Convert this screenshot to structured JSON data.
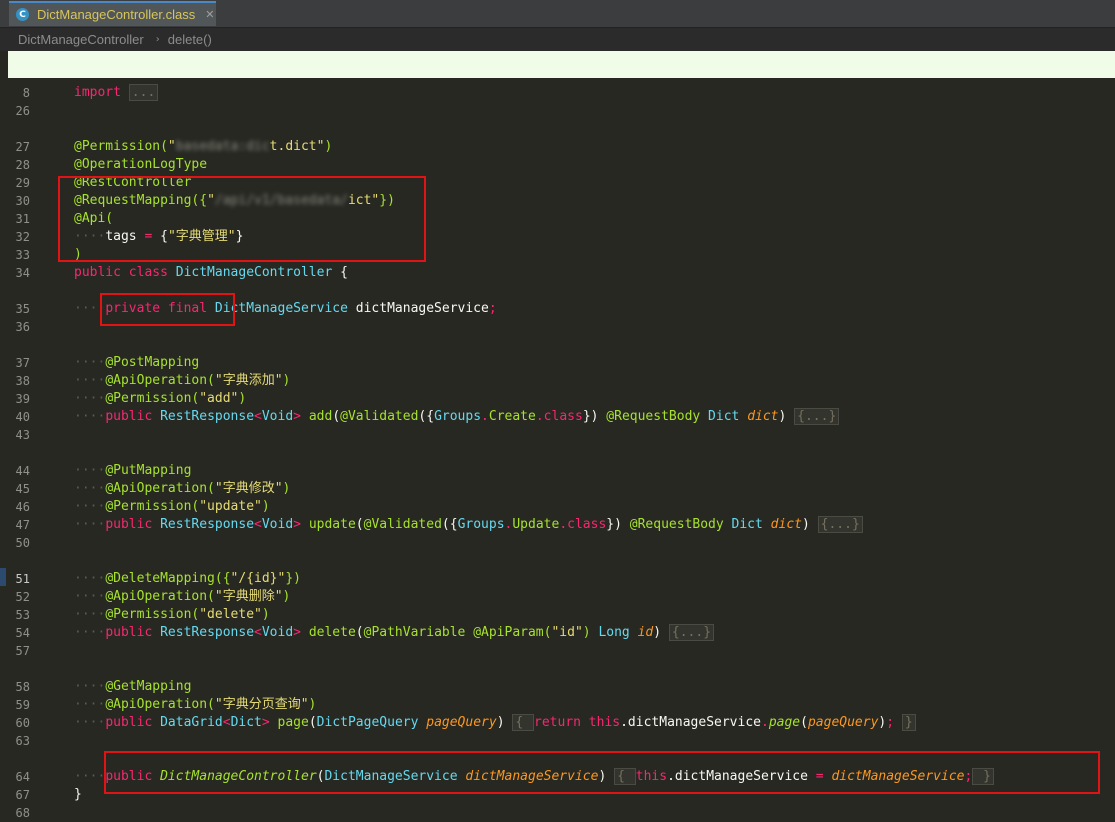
{
  "tab": {
    "title": "DictManageController.class",
    "close": "✕",
    "icon": "C"
  },
  "breadcrumb": {
    "class_name": "DictManageController",
    "separator": "›",
    "method": "delete()"
  },
  "current_line": "51",
  "lines": [
    {
      "n": "8",
      "tokens": [
        [
          "kw",
          "import"
        ],
        [
          "p",
          " "
        ],
        [
          "fold",
          "..."
        ]
      ]
    },
    {
      "n": "26",
      "tokens": []
    },
    {
      "n": "27",
      "tokens": [
        [
          "an",
          "@Permission("
        ],
        [
          "st",
          "\""
        ],
        [
          "blur",
          "basedata:dic"
        ],
        [
          "st",
          "t.dict\""
        ],
        [
          "an",
          ")"
        ]
      ]
    },
    {
      "n": "28",
      "tokens": [
        [
          "an",
          "@OperationLogType"
        ]
      ]
    },
    {
      "n": "29",
      "tokens": [
        [
          "an",
          "@RestController"
        ]
      ]
    },
    {
      "n": "30",
      "tokens": [
        [
          "an",
          "@RequestMapping({"
        ],
        [
          "st",
          "\""
        ],
        [
          "blur",
          "/api/v1/basedata/"
        ],
        [
          "st",
          "ict\""
        ],
        [
          "an",
          "})"
        ]
      ]
    },
    {
      "n": "31",
      "tokens": [
        [
          "an",
          "@Api("
        ]
      ]
    },
    {
      "n": "32",
      "tokens": [
        [
          "ind",
          "····"
        ],
        [
          "fld",
          "tags "
        ],
        [
          "kw",
          "="
        ],
        [
          "fld",
          " {"
        ],
        [
          "st",
          "\"字典管理\""
        ],
        [
          "fld",
          "}"
        ]
      ]
    },
    {
      "n": "33",
      "tokens": [
        [
          "an",
          ")"
        ]
      ]
    },
    {
      "n": "34",
      "tokens": [
        [
          "kw",
          "public class "
        ],
        [
          "ty",
          "DictManageController"
        ],
        [
          "fld",
          " {"
        ]
      ]
    },
    {
      "n": "35",
      "tokens": [
        [
          "ind",
          "····"
        ],
        [
          "kw",
          "private final "
        ],
        [
          "ty",
          "DictManageService"
        ],
        [
          "fld",
          " dictManageService"
        ],
        [
          "kw",
          ";"
        ]
      ]
    },
    {
      "n": "36",
      "tokens": []
    },
    {
      "n": "37",
      "tokens": [
        [
          "ind",
          "····"
        ],
        [
          "an",
          "@PostMapping"
        ]
      ]
    },
    {
      "n": "38",
      "tokens": [
        [
          "ind",
          "····"
        ],
        [
          "an",
          "@ApiOperation("
        ],
        [
          "st",
          "\"字典添加\""
        ],
        [
          "an",
          ")"
        ]
      ]
    },
    {
      "n": "39",
      "tokens": [
        [
          "ind",
          "····"
        ],
        [
          "an",
          "@Permission("
        ],
        [
          "st",
          "\"add\""
        ],
        [
          "an",
          ")"
        ]
      ]
    },
    {
      "n": "40",
      "tokens": [
        [
          "ind",
          "····"
        ],
        [
          "kw",
          "public "
        ],
        [
          "ty",
          "RestResponse"
        ],
        [
          "kw",
          "<"
        ],
        [
          "ty",
          "Void"
        ],
        [
          "kw",
          "> "
        ],
        [
          "an",
          "add"
        ],
        [
          "fld",
          "("
        ],
        [
          "an",
          "@Validated"
        ],
        [
          "fld",
          "({"
        ],
        [
          "ty",
          "Groups"
        ],
        [
          "kw",
          "."
        ],
        [
          "an",
          "Create"
        ],
        [
          "kw",
          ".class"
        ],
        [
          "fld",
          "}) "
        ],
        [
          "an",
          "@RequestBody "
        ],
        [
          "ty",
          "Dict "
        ],
        [
          "pa",
          "dict"
        ],
        [
          "fld",
          ") "
        ],
        [
          "fold",
          "{...}"
        ]
      ]
    },
    {
      "n": "43",
      "tokens": []
    },
    {
      "n": "44",
      "tokens": [
        [
          "ind",
          "····"
        ],
        [
          "an",
          "@PutMapping"
        ]
      ]
    },
    {
      "n": "45",
      "tokens": [
        [
          "ind",
          "····"
        ],
        [
          "an",
          "@ApiOperation("
        ],
        [
          "st",
          "\"字典修改\""
        ],
        [
          "an",
          ")"
        ]
      ]
    },
    {
      "n": "46",
      "tokens": [
        [
          "ind",
          "····"
        ],
        [
          "an",
          "@Permission("
        ],
        [
          "st",
          "\"update\""
        ],
        [
          "an",
          ")"
        ]
      ]
    },
    {
      "n": "47",
      "tokens": [
        [
          "ind",
          "····"
        ],
        [
          "kw",
          "public "
        ],
        [
          "ty",
          "RestResponse"
        ],
        [
          "kw",
          "<"
        ],
        [
          "ty",
          "Void"
        ],
        [
          "kw",
          "> "
        ],
        [
          "an",
          "update"
        ],
        [
          "fld",
          "("
        ],
        [
          "an",
          "@Validated"
        ],
        [
          "fld",
          "({"
        ],
        [
          "ty",
          "Groups"
        ],
        [
          "kw",
          "."
        ],
        [
          "an",
          "Update"
        ],
        [
          "kw",
          ".class"
        ],
        [
          "fld",
          "}) "
        ],
        [
          "an",
          "@RequestBody "
        ],
        [
          "ty",
          "Dict "
        ],
        [
          "pa",
          "dict"
        ],
        [
          "fld",
          ") "
        ],
        [
          "fold",
          "{...}"
        ]
      ]
    },
    {
      "n": "50",
      "tokens": []
    },
    {
      "n": "51",
      "tokens": [
        [
          "ind",
          "····"
        ],
        [
          "an",
          "@DeleteMapping({"
        ],
        [
          "st",
          "\"/{id}\""
        ],
        [
          "an",
          "})"
        ]
      ]
    },
    {
      "n": "52",
      "tokens": [
        [
          "ind",
          "····"
        ],
        [
          "an",
          "@ApiOperation("
        ],
        [
          "st",
          "\"字典删除\""
        ],
        [
          "an",
          ")"
        ]
      ]
    },
    {
      "n": "53",
      "tokens": [
        [
          "ind",
          "····"
        ],
        [
          "an",
          "@Permission("
        ],
        [
          "st",
          "\"delete\""
        ],
        [
          "an",
          ")"
        ]
      ]
    },
    {
      "n": "54",
      "tokens": [
        [
          "ind",
          "····"
        ],
        [
          "kw",
          "public "
        ],
        [
          "ty",
          "RestResponse"
        ],
        [
          "kw",
          "<"
        ],
        [
          "ty",
          "Void"
        ],
        [
          "kw",
          "> "
        ],
        [
          "an",
          "delete"
        ],
        [
          "fld",
          "("
        ],
        [
          "an",
          "@PathVariable @ApiParam("
        ],
        [
          "st",
          "\"id\""
        ],
        [
          "an",
          ") "
        ],
        [
          "ty",
          "Long "
        ],
        [
          "pa",
          "id"
        ],
        [
          "fld",
          ") "
        ],
        [
          "fold",
          "{...}"
        ]
      ]
    },
    {
      "n": "57",
      "tokens": []
    },
    {
      "n": "58",
      "tokens": [
        [
          "ind",
          "····"
        ],
        [
          "an",
          "@GetMapping"
        ]
      ]
    },
    {
      "n": "59",
      "tokens": [
        [
          "ind",
          "····"
        ],
        [
          "an",
          "@ApiOperation("
        ],
        [
          "st",
          "\"字典分页查询\""
        ],
        [
          "an",
          ")"
        ]
      ]
    },
    {
      "n": "60",
      "tokens": [
        [
          "ind",
          "····"
        ],
        [
          "kw",
          "public "
        ],
        [
          "ty",
          "DataGrid"
        ],
        [
          "kw",
          "<"
        ],
        [
          "ty",
          "Dict"
        ],
        [
          "kw",
          "> "
        ],
        [
          "an",
          "page"
        ],
        [
          "fld",
          "("
        ],
        [
          "ty",
          "DictPageQuery "
        ],
        [
          "pa",
          "pageQuery"
        ],
        [
          "fld",
          ") "
        ],
        [
          "fold",
          "{ "
        ],
        [
          "kw",
          "return this"
        ],
        [
          "fld",
          ".dictManageService"
        ],
        [
          "kw",
          "."
        ],
        [
          "mi",
          "page"
        ],
        [
          "fld",
          "("
        ],
        [
          "pa",
          "pageQuery"
        ],
        [
          "fld",
          ")"
        ],
        [
          "kw",
          "; "
        ],
        [
          "fold",
          "}"
        ]
      ]
    },
    {
      "n": "63",
      "tokens": []
    },
    {
      "n": "64",
      "tokens": [
        [
          "ind",
          "····"
        ],
        [
          "kw",
          "public "
        ],
        [
          "mi",
          "DictManageController"
        ],
        [
          "fld",
          "("
        ],
        [
          "ty",
          "DictManageService "
        ],
        [
          "pa",
          "dictManageService"
        ],
        [
          "fld",
          ") "
        ],
        [
          "fold",
          "{ "
        ],
        [
          "kw",
          "this"
        ],
        [
          "fld",
          ".dictManageService "
        ],
        [
          "kw",
          "= "
        ],
        [
          "pa",
          "dictManageService"
        ],
        [
          "kw",
          ";"
        ],
        [
          "fold",
          " }"
        ]
      ]
    },
    {
      "n": "67",
      "tokens": [
        [
          "fld",
          "}"
        ]
      ]
    },
    {
      "n": "68",
      "tokens": []
    }
  ]
}
